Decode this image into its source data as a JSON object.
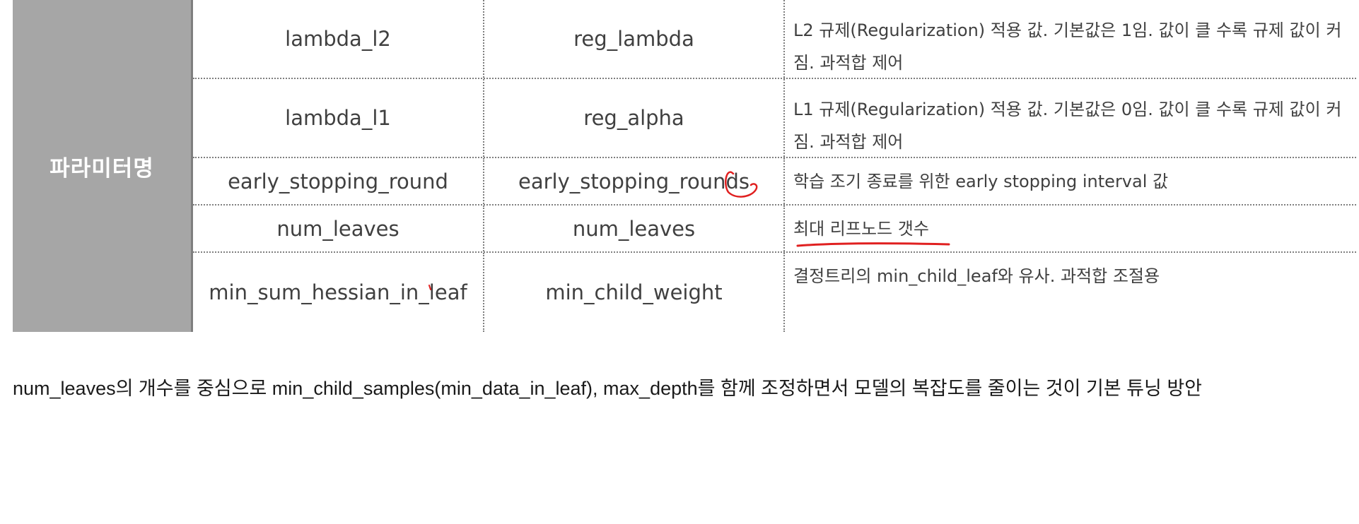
{
  "table": {
    "side_label": "파라미터명",
    "rows": [
      {
        "lightgbm": "lambda_l2",
        "sklearn": "reg_lambda",
        "description": "L2 규제(Regularization) 적용 값. 기본값은 1임. 값이 클 수록 규제 값이 커짐. 과적합 제어"
      },
      {
        "lightgbm": "lambda_l1",
        "sklearn": "reg_alpha",
        "description": "L1 규제(Regularization) 적용 값. 기본값은 0임. 값이 클 수록 규제 값이 커짐.  과적합 제어"
      },
      {
        "lightgbm": "early_stopping_round",
        "sklearn": "early_stopping_rounds",
        "description": "학습 조기 종료를 위한 early stopping interval 값"
      },
      {
        "lightgbm": "num_leaves",
        "sklearn": "num_leaves",
        "description": "최대 리프노드 갯수"
      },
      {
        "lightgbm": "min_sum_hessian_in_leaf",
        "sklearn": "min_child_weight",
        "description": "결정트리의 min_child_leaf와 유사. 과적합 조절용"
      }
    ]
  },
  "note": "num_leaves의 개수를 중심으로 min_child_samples(min_data_in_leaf), max_depth를 함께 조정하면서 모델의 복잡도를 줄이는 것이 기본 튜닝 방안",
  "colors": {
    "side_bg": "#a6a6a6",
    "annotation": "#e02020"
  }
}
